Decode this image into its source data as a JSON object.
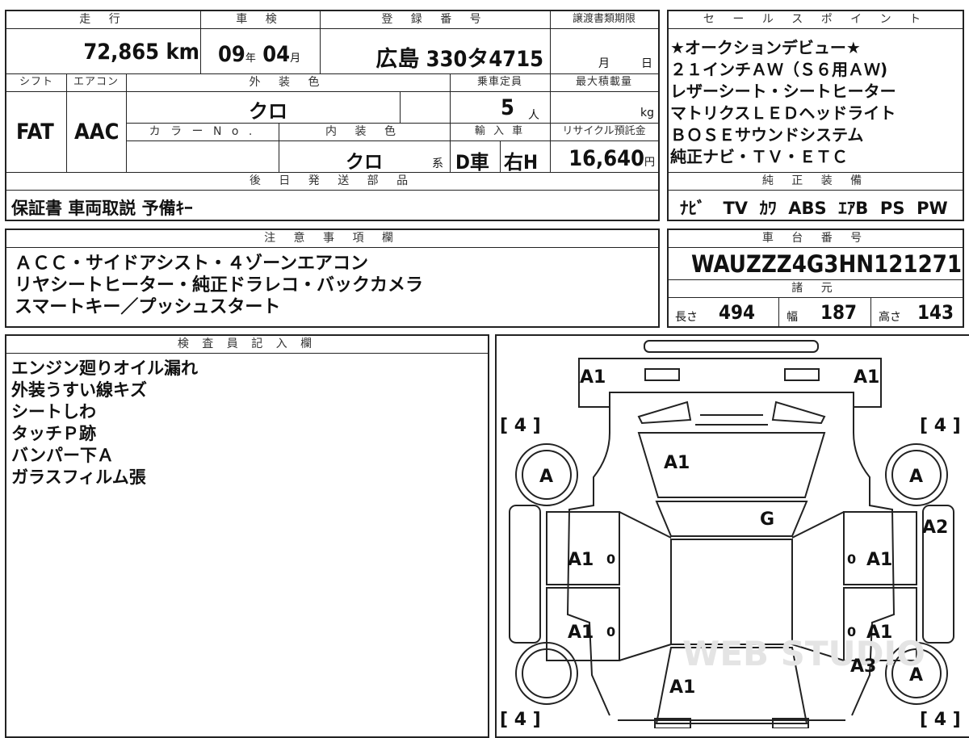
{
  "top": {
    "mileage_header": "走 行",
    "mileage": "72,865",
    "mileage_unit": "km",
    "inspection_header": "車 検",
    "inspection_year": "09",
    "inspection_year_unit": "年",
    "inspection_month": "04",
    "inspection_month_unit": "月",
    "registration_header": "登 録 番 号",
    "registration": "広島 330タ4715",
    "transfer_header": "譲渡書類期限",
    "transfer_month_unit": "月",
    "transfer_day_unit": "日",
    "shift_header": "シフト",
    "shift": "FAT",
    "ac_header": "エアコン",
    "ac": "AAC",
    "exterior_header": "外 装 色",
    "exterior": "クロ",
    "capacity_header": "乗車定員",
    "capacity": "5",
    "capacity_unit": "人",
    "load_header": "最大積載量",
    "load_unit": "kg",
    "color_no_header": "カ ラ ー N o .",
    "interior_header": "内 装 色",
    "interior": "クロ",
    "interior_suffix": "系",
    "import_header": "輸 入 車",
    "import_type": "D車",
    "steering": "右H",
    "recycle_header": "リサイクル預託金",
    "recycle": "16,640",
    "recycle_unit": "円"
  },
  "later_parts": {
    "header": "後 日 発 送 部 品",
    "value": "保証書 車両取説 予備ｷｰ"
  },
  "sales_points": {
    "header": "セ ー ル ス ポ イ ン ト",
    "lines": [
      "★オークションデビュー★",
      "２１インチＡＷ（Ｓ６用ＡＷ)",
      "レザーシート・シートヒーター",
      "マトリクスＬＥＤヘッドライト",
      "ＢＯＳＥサウンドシステム",
      "純正ナビ・ＴＶ・ＥＴＣ"
    ]
  },
  "equipment": {
    "header": "純 正 装 備",
    "items": [
      "ﾅﾋﾞ",
      "TV",
      "ｶﾜ",
      "ABS",
      "ｴｱB",
      "PS",
      "PW"
    ]
  },
  "notes": {
    "header": "注 意 事 項 欄",
    "lines": [
      "ＡＣＣ・サイドアシスト・４ゾーンエアコン",
      "リヤシートヒーター・純正ドラレコ・バックカメラ",
      "スマートキー／プッシュスタート"
    ]
  },
  "chassis": {
    "header": "車 台 番 号",
    "value": "WAUZZZ4G3HN121271"
  },
  "specs": {
    "header": "諸 元",
    "length_label": "長さ",
    "length": "494",
    "width_label": "幅",
    "width": "187",
    "height_label": "高さ",
    "height": "143"
  },
  "inspector": {
    "header": "検 査 員 記 入 欄",
    "lines": [
      "エンジン廻りオイル漏れ",
      "外装うすい線キズ",
      "シートしわ",
      "タッチＰ跡",
      "バンパー下Ａ",
      "ガラスフィルム張"
    ]
  },
  "diagram": {
    "front_left": "A1",
    "front_right": "A1",
    "bracket_tl": "[ 4 ]",
    "bracket_tr": "[ 4 ]",
    "bracket_bl": "[ 4 ]",
    "bracket_br": "[ 4 ]",
    "wheel_fl": "A",
    "wheel_fr": "A",
    "wheel_rr": "A",
    "hood": "A1",
    "windshield": "G",
    "fender_right": "A2",
    "door_fl": "A1",
    "door_fr": "A1",
    "door_rl": "A1",
    "door_rr": "A1",
    "handle_mark": "0",
    "quarter_right": "A3",
    "trunk": "A1",
    "watermark": "WEB STUDIO"
  }
}
